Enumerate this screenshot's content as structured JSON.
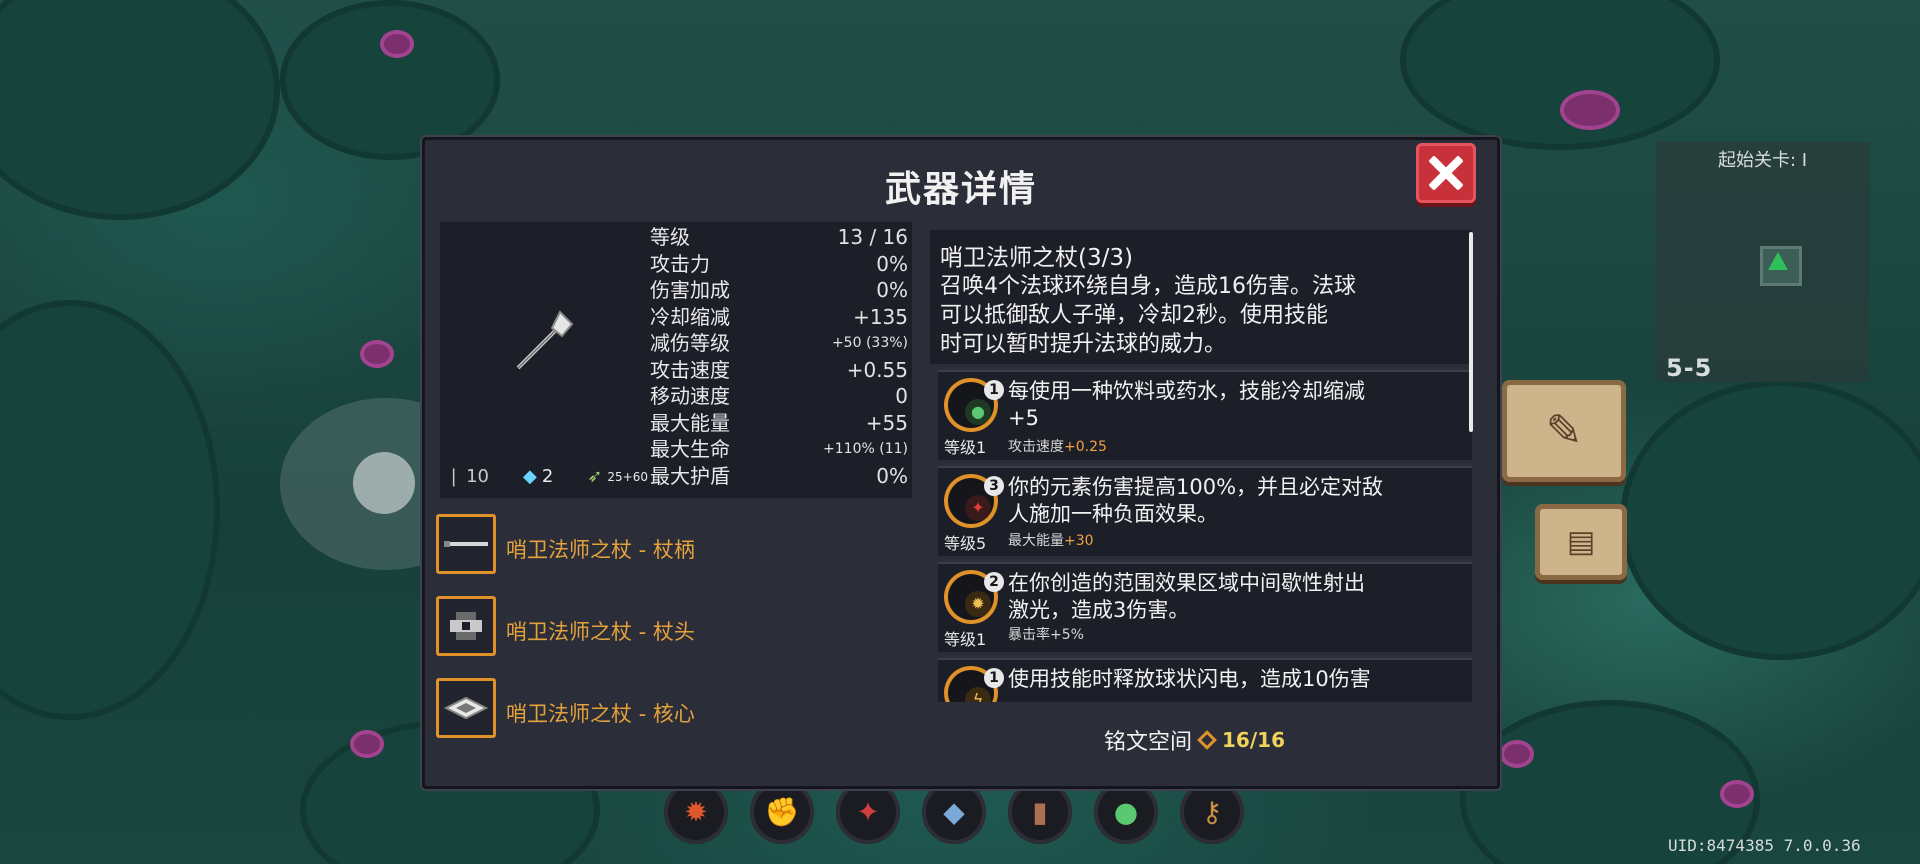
{
  "modal": {
    "title": "武器详情",
    "close_icon": "close-icon"
  },
  "weapon": {
    "icon": "staff-icon",
    "stats": [
      {
        "label": "等级",
        "value": "13 / 16"
      },
      {
        "label": "攻击力",
        "value": "0%"
      },
      {
        "label": "伤害加成",
        "value": "0%"
      },
      {
        "label": "冷却缩减",
        "value": "+135"
      },
      {
        "label": "减伤等级",
        "value": "+50 (33%)"
      },
      {
        "label": "攻击速度",
        "value": "+0.55"
      },
      {
        "label": "移动速度",
        "value": "0"
      },
      {
        "label": "最大能量",
        "value": "+55"
      },
      {
        "label": "最大生命",
        "value": "+110% (11)"
      },
      {
        "label": "最大护盾",
        "value": "0%"
      }
    ],
    "footer_stats": [
      {
        "icon": "ammo-icon",
        "value": "10"
      },
      {
        "icon": "gem-icon",
        "value": "2"
      },
      {
        "icon": "energy-icon",
        "value": "25+60"
      }
    ],
    "parts": [
      {
        "icon": "staff-handle-icon",
        "label": "哨卫法师之杖 - 杖柄"
      },
      {
        "icon": "staff-head-icon",
        "label": "哨卫法师之杖 - 杖头"
      },
      {
        "icon": "staff-core-icon",
        "label": "哨卫法师之杖 - 核心"
      }
    ]
  },
  "description": {
    "title": "哨卫法师之杖(3/3)",
    "lines": [
      "召唤4个法球环绕自身，造成16伤害。法球",
      "可以抵御敌人子弹，冷却2秒。使用技能",
      "时可以暂时提升法球的威力。"
    ]
  },
  "inscriptions": [
    {
      "badge": "1",
      "icon": "potion-icon",
      "text_lines": [
        "每使用一种饮料或药水，技能冷却缩减",
        "+5"
      ],
      "level": "等级1",
      "bonus_label": "攻击速度",
      "bonus_value": "+0.25"
    },
    {
      "badge": "3",
      "icon": "element-icon",
      "text_lines": [
        "你的元素伤害提高100%，并且必定对敌",
        "人施加一种负面效果。"
      ],
      "level": "等级5",
      "bonus_label": "最大能量",
      "bonus_value": "+30"
    },
    {
      "badge": "2",
      "icon": "burst-icon",
      "text_lines": [
        "在你创造的范围效果区域中间歇性射出",
        "激光，造成3伤害。"
      ],
      "level": "等级1",
      "bonus_label": "暴击率+5%",
      "bonus_value": ""
    },
    {
      "badge": "1",
      "icon": "lightning-icon",
      "text_lines": [
        "使用技能时释放球状闪电，造成10伤害"
      ],
      "level": "",
      "bonus_label": "",
      "bonus_value": ""
    }
  ],
  "inscription_space": {
    "label": "铭文空间",
    "value": "16/16"
  },
  "minimap": {
    "title": "起始关卡: I",
    "level": "5-5"
  },
  "uid_text": "UID:8474385 7.0.0.36",
  "skillbar": [
    "skill-fire-icon",
    "skill-fist-icon",
    "skill-slash-icon",
    "skill-shield-icon",
    "skill-book-icon",
    "skill-potion-icon",
    "skill-key-icon"
  ]
}
